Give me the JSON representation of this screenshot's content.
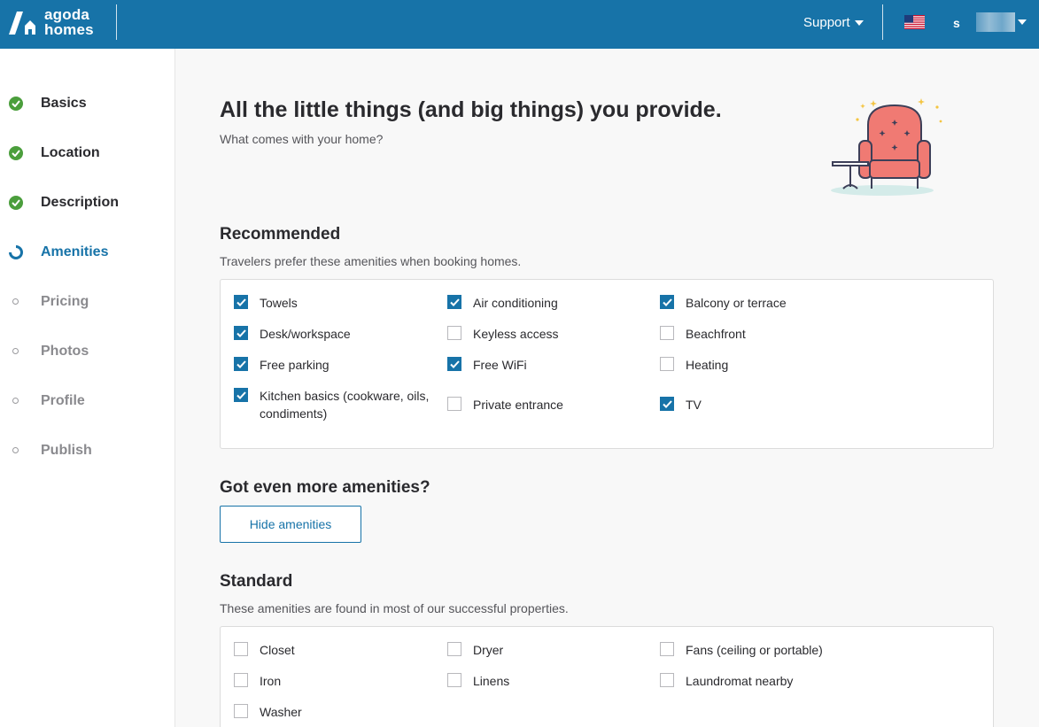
{
  "header": {
    "logo_line1": "agoda",
    "logo_line2": "homes",
    "support_label": "Support",
    "user_initial": "s",
    "brand_color": "#1773a8"
  },
  "sidebar": {
    "steps": [
      {
        "label": "Basics",
        "status": "done"
      },
      {
        "label": "Location",
        "status": "done"
      },
      {
        "label": "Description",
        "status": "done"
      },
      {
        "label": "Amenities",
        "status": "current"
      },
      {
        "label": "Pricing",
        "status": "todo"
      },
      {
        "label": "Photos",
        "status": "todo"
      },
      {
        "label": "Profile",
        "status": "todo"
      },
      {
        "label": "Publish",
        "status": "todo"
      }
    ]
  },
  "main": {
    "title": "All the little things (and big things) you provide.",
    "subtitle": "What comes with your home?",
    "recommended": {
      "title": "Recommended",
      "subtitle": "Travelers prefer these amenities when booking homes.",
      "items": [
        {
          "label": "Towels",
          "checked": true
        },
        {
          "label": "Air conditioning",
          "checked": true
        },
        {
          "label": "Balcony or terrace",
          "checked": true
        },
        {
          "label": "Desk/workspace",
          "checked": true
        },
        {
          "label": "Keyless access",
          "checked": false
        },
        {
          "label": "Beachfront",
          "checked": false
        },
        {
          "label": "Free parking",
          "checked": true
        },
        {
          "label": "Free WiFi",
          "checked": true
        },
        {
          "label": "Heating",
          "checked": false
        },
        {
          "label": "Kitchen basics (cookware, oils, condiments)",
          "checked": true
        },
        {
          "label": "Private entrance",
          "checked": false
        },
        {
          "label": "TV",
          "checked": true
        }
      ]
    },
    "more": {
      "title": "Got even more amenities?",
      "button_label": "Hide amenities"
    },
    "standard": {
      "title": "Standard",
      "subtitle": "These amenities are found in most of our successful properties.",
      "items": [
        {
          "label": "Closet",
          "checked": false
        },
        {
          "label": "Dryer",
          "checked": false
        },
        {
          "label": "Fans (ceiling or portable)",
          "checked": false
        },
        {
          "label": "Iron",
          "checked": false
        },
        {
          "label": "Linens",
          "checked": false
        },
        {
          "label": "Laundromat nearby",
          "checked": false
        },
        {
          "label": "Washer",
          "checked": false
        }
      ]
    }
  }
}
